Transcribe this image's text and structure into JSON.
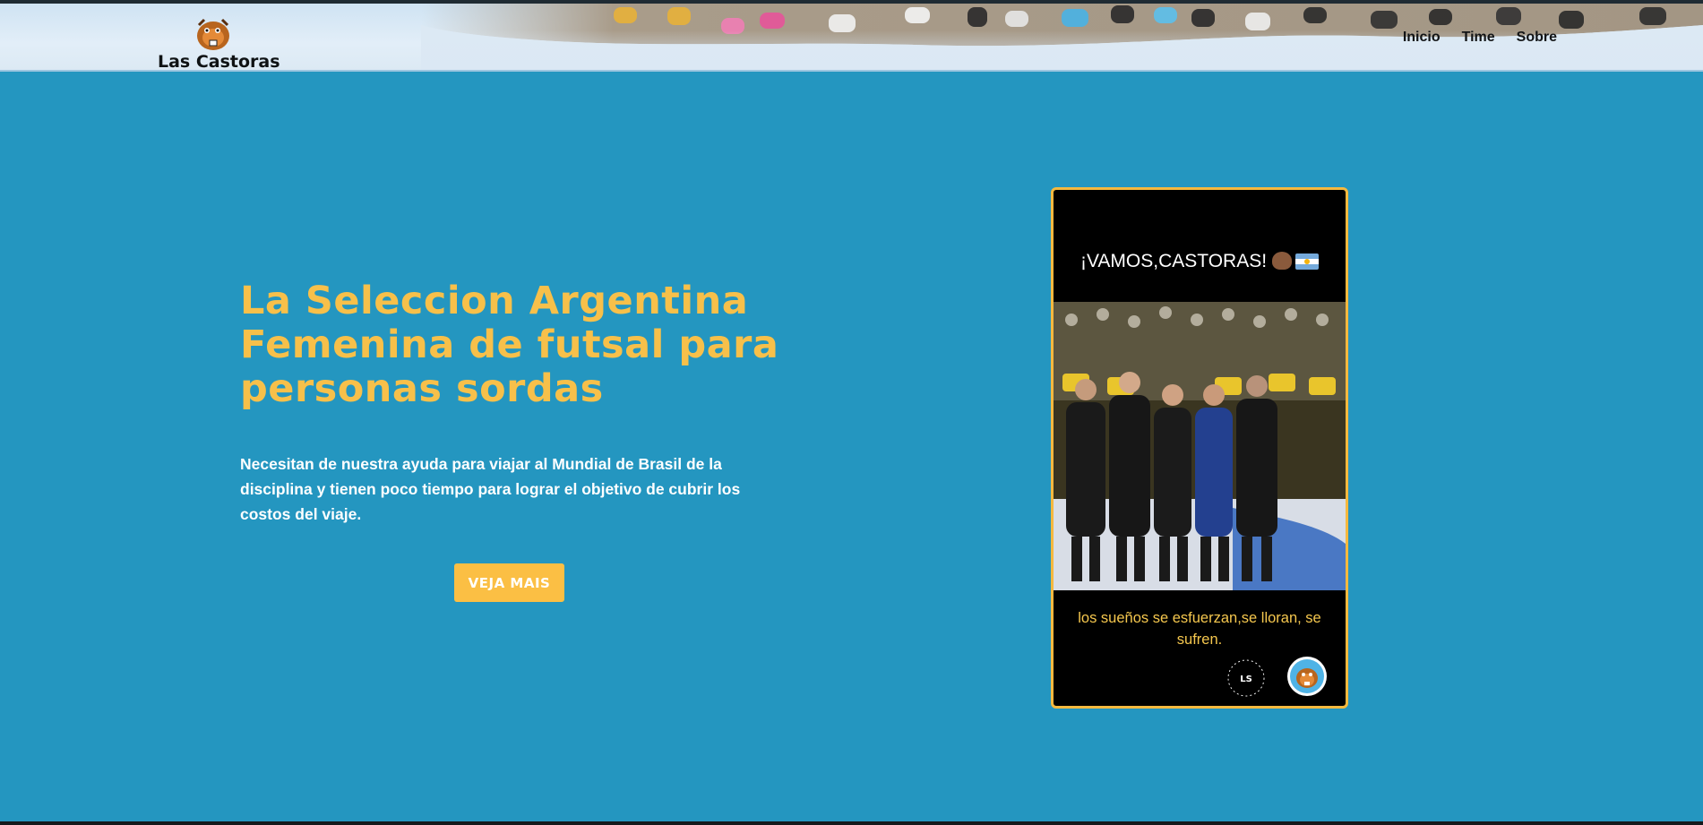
{
  "header": {
    "brand_name": "Las Castoras",
    "nav": [
      {
        "label": "Inicio"
      },
      {
        "label": "Time"
      },
      {
        "label": "Sobre"
      }
    ]
  },
  "hero": {
    "title": "La Seleccion Argentina Femenina de futsal para personas sordas",
    "description": "Necesitan de nuestra ayuda para viajar al Mundial de Brasil de la disciplina y tienen poco tiempo para lograr el objetivo de cubrir los costos del viaje.",
    "button_label": "VEJA MAIS"
  },
  "poster": {
    "heading": "¡VAMOS,CASTORAS!",
    "caption": "los sueños se esfuerzan,se lloran, se sufren.",
    "badge_text": "LS"
  },
  "colors": {
    "page_background": "#2496c0",
    "accent_yellow": "#f7c04a",
    "button": "#fbbf44",
    "poster_border": "#f5b93f"
  },
  "icons": [
    "beaver-logo-icon",
    "beaver-emoji-icon",
    "argentina-flag-icon",
    "ls-badge-icon",
    "castoras-badge-icon"
  ]
}
